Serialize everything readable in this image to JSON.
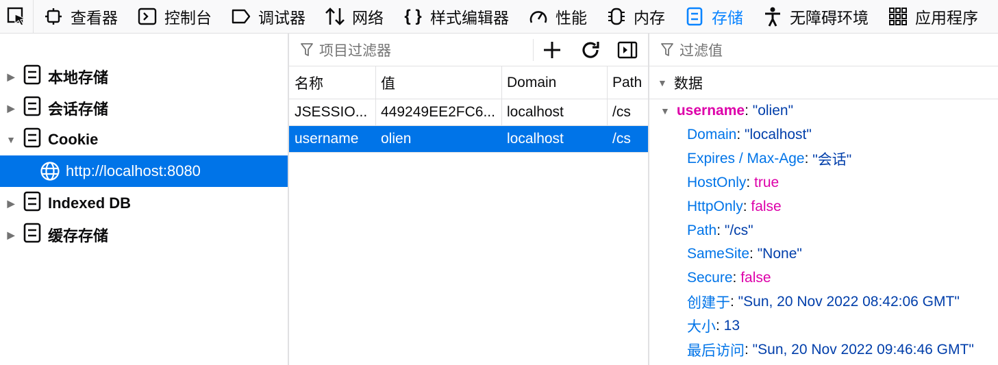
{
  "toolbar": {
    "tabs": [
      {
        "label": "查看器",
        "icon": "inspector-icon"
      },
      {
        "label": "控制台",
        "icon": "console-icon"
      },
      {
        "label": "调试器",
        "icon": "debugger-icon"
      },
      {
        "label": "网络",
        "icon": "network-icon"
      },
      {
        "label": "样式编辑器",
        "icon": "style-editor-icon"
      },
      {
        "label": "性能",
        "icon": "performance-icon"
      },
      {
        "label": "内存",
        "icon": "memory-icon"
      },
      {
        "label": "存储",
        "icon": "storage-icon",
        "active": true
      },
      {
        "label": "无障碍环境",
        "icon": "accessibility-icon"
      },
      {
        "label": "应用程序",
        "icon": "application-icon"
      }
    ]
  },
  "tree": {
    "items": [
      {
        "label": "本地存储"
      },
      {
        "label": "会话存储"
      },
      {
        "label": "Cookie"
      },
      {
        "label": "http://localhost:8080"
      },
      {
        "label": "Indexed DB"
      },
      {
        "label": "缓存存储"
      }
    ]
  },
  "table": {
    "filter_placeholder": "项目过滤器",
    "headers": [
      "名称",
      "值",
      "Domain",
      "Path"
    ],
    "rows": [
      [
        "JSESSIO...",
        "449249EE2FC6...",
        "localhost",
        "/cs"
      ],
      [
        "username",
        "olien",
        "localhost",
        "/cs"
      ]
    ]
  },
  "details": {
    "filter_placeholder": "过滤值",
    "section_label": "数据",
    "root_key": "username",
    "root_value": "\"olien\"",
    "props": [
      {
        "key": "Domain",
        "value": "\"localhost\""
      },
      {
        "key": "Expires / Max-Age",
        "value": "\"会话\""
      },
      {
        "key": "HostOnly",
        "value": "true"
      },
      {
        "key": "HttpOnly",
        "value": "false"
      },
      {
        "key": "Path",
        "value": "\"/cs\""
      },
      {
        "key": "SameSite",
        "value": "\"None\""
      },
      {
        "key": "Secure",
        "value": "false"
      },
      {
        "key": "创建于",
        "value": "\"Sun, 20 Nov 2022 08:42:06 GMT\""
      },
      {
        "key": "大小",
        "value": "13"
      },
      {
        "key": "最后访问",
        "value": "\"Sun, 20 Nov 2022 09:46:46 GMT\""
      }
    ]
  },
  "colors": {
    "accent": "#0a84ff",
    "selection": "#0074e8",
    "key": "#0074e8",
    "string": "#003eaa",
    "bool": "#dd00a9"
  }
}
